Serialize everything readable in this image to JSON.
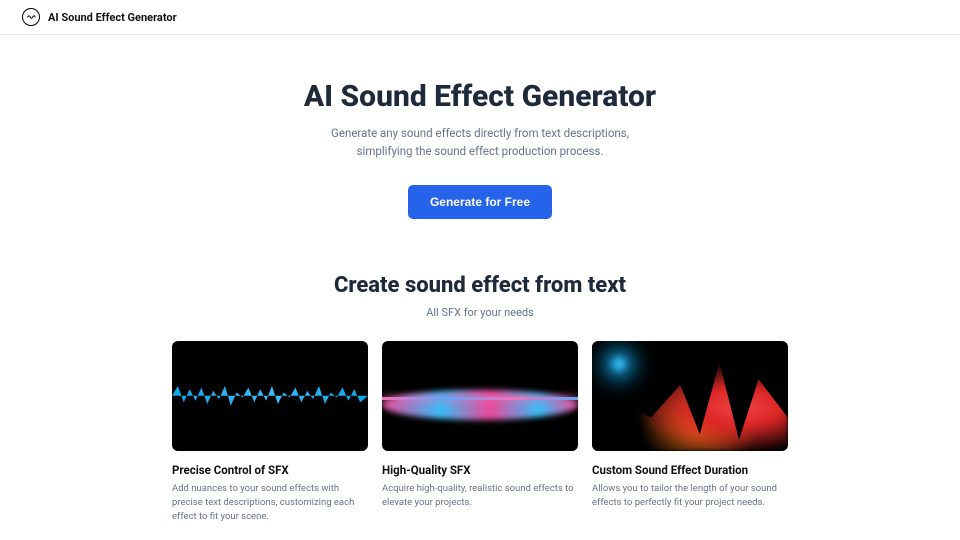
{
  "header": {
    "brand": "AI Sound Effect Generator"
  },
  "hero": {
    "title": "AI Sound Effect Generator",
    "subtitle1": "Generate any sound effects directly from text descriptions,",
    "subtitle2": "simplifying the sound effect production process.",
    "cta": "Generate for Free"
  },
  "features": {
    "title": "Create sound effect from text",
    "subtitle": "All SFX for your needs",
    "cards": [
      {
        "title": "Precise Control of SFX",
        "desc": "Add nuances to your sound effects with precise text descriptions, customizing each effect to fit your scene."
      },
      {
        "title": "High-Quality SFX",
        "desc": "Acquire high-quality, realistic sound effects to elevate your projects."
      },
      {
        "title": "Custom Sound Effect Duration",
        "desc": "Allows you to tailor the length of your sound effects to perfectly fit your project needs."
      }
    ]
  }
}
